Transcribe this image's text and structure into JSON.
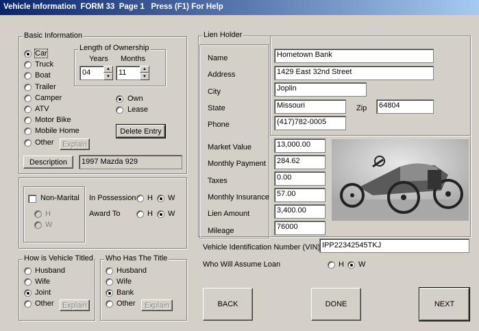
{
  "title": "Vehicle Information  FORM 33  Page 1   Press (F1) For Help",
  "basic": {
    "legend": "Basic Information",
    "types": [
      "Car",
      "Truck",
      "Boat",
      "Trailer",
      "Camper",
      "ATV",
      "Motor Bike",
      "Mobile Home",
      "Other"
    ],
    "selected_type": "Car",
    "explain_label": "Explain",
    "ownership": {
      "legend": "Length of Ownership",
      "years_label": "Years",
      "months_label": "Months",
      "years": "04",
      "months": "11"
    },
    "own_label": "Own",
    "lease_label": "Lease",
    "own_selected": "Own",
    "delete_label": "Delete Entry",
    "description_label": "Description",
    "description_value": "1997 Mazda 929"
  },
  "marital": {
    "non_marital_label": "Non-Marital",
    "h_label": "H",
    "w_label": "W",
    "in_possession_label": "In Possession",
    "in_possession_selected": "W",
    "award_to_label": "Award To",
    "award_to_selected": "W"
  },
  "titled": {
    "legend": "How is Vehicle Titled",
    "options": [
      "Husband",
      "Wife",
      "Joint",
      "Other"
    ],
    "selected": "Joint",
    "explain_label": "Explain"
  },
  "holder": {
    "legend": "Who Has The Title",
    "options": [
      "Husband",
      "Wife",
      "Bank",
      "Other"
    ],
    "selected": "Bank",
    "explain_label": "Explain"
  },
  "lien": {
    "legend": "Lien Holder",
    "name_label": "Name",
    "name": "Hometown Bank",
    "address_label": "Address",
    "address": "1429 East 32nd Street",
    "city_label": "City",
    "city": "Joplin",
    "state_label": "State",
    "state": "Missouri",
    "zip_label": "Zip",
    "zip": "64804",
    "phone_label": "Phone",
    "phone": "(417)782-0005",
    "market_value_label": "Market Value",
    "market_value": "13,000.00",
    "monthly_payment_label": "Monthly Payment",
    "monthly_payment": "284.62",
    "taxes_label": "Taxes",
    "taxes": "0.00",
    "insurance_label": "Monthly Insurance",
    "insurance": "57.00",
    "lien_amount_label": "Lien Amount",
    "lien_amount": "3,400.00",
    "mileage_label": "Mileage",
    "mileage": "76000"
  },
  "vin": {
    "label": "Vehicle Identification Number (VIN)",
    "value": "IPP22342545TKJ"
  },
  "assume": {
    "label": "Who  Will Assume Loan",
    "h_label": "H",
    "w_label": "W",
    "selected": "W"
  },
  "nav": {
    "back": "BACK",
    "done": "DONE",
    "next": "NEXT"
  },
  "icons": {
    "photo": "antique-car-photo"
  }
}
